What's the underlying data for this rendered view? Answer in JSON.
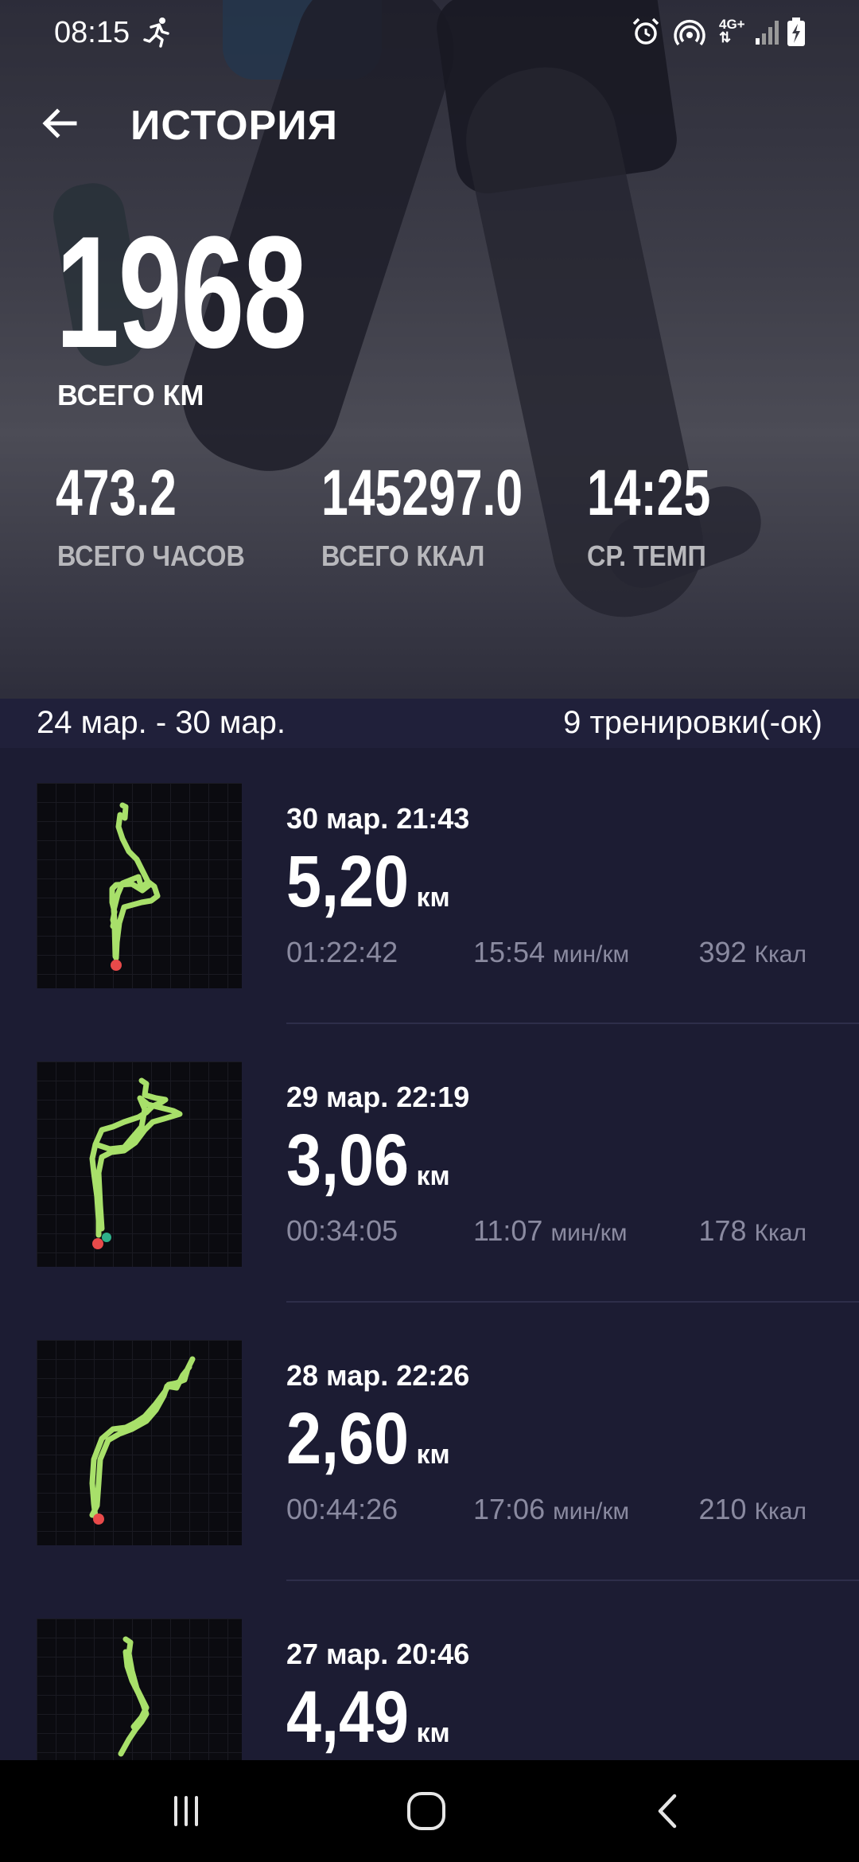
{
  "status_bar": {
    "time": "08:15",
    "network": "4G+",
    "icons": [
      "running-icon",
      "alarm-icon",
      "hotspot-icon",
      "signal-icon",
      "battery-charging-icon"
    ]
  },
  "header": {
    "title": "ИСТОРИЯ",
    "back_icon": "arrow-left-icon"
  },
  "summary": {
    "total_km": "1968",
    "total_km_label": "ВСЕГО КМ",
    "stats": [
      {
        "value": "473.2",
        "label": "ВСЕГО ЧАСОВ"
      },
      {
        "value": "145297.0",
        "label": "ВСЕГО ККАЛ"
      },
      {
        "value": "14:25",
        "label": "СР. ТЕМП"
      }
    ]
  },
  "week": {
    "range": "24 мар. - 30 мар.",
    "count": "9 тренировки(-ок)"
  },
  "workouts": [
    {
      "date": "30 мар. 21:43",
      "distance": "5,20",
      "unit": "км",
      "duration": "01:22:42",
      "pace": "15:54",
      "pace_unit": "мин/км",
      "kcal": "392",
      "kcal_unit": "Ккал"
    },
    {
      "date": "29 мар. 22:19",
      "distance": "3,06",
      "unit": "км",
      "duration": "00:34:05",
      "pace": "11:07",
      "pace_unit": "мин/км",
      "kcal": "178",
      "kcal_unit": "Ккал"
    },
    {
      "date": "28 мар. 22:26",
      "distance": "2,60",
      "unit": "км",
      "duration": "00:44:26",
      "pace": "17:06",
      "pace_unit": "мин/км",
      "kcal": "210",
      "kcal_unit": "Ккал"
    },
    {
      "date": "27 мар. 20:46",
      "distance": "4,49",
      "unit": "км"
    }
  ],
  "colors": {
    "background": "#1c1c33",
    "route": "#a8e06a",
    "start_marker": "#e84a4a",
    "end_marker": "#2fb08a",
    "muted_text": "#8a8aa0"
  },
  "nav_bar": {
    "icons": [
      "recent-apps-icon",
      "home-icon",
      "back-icon"
    ]
  }
}
